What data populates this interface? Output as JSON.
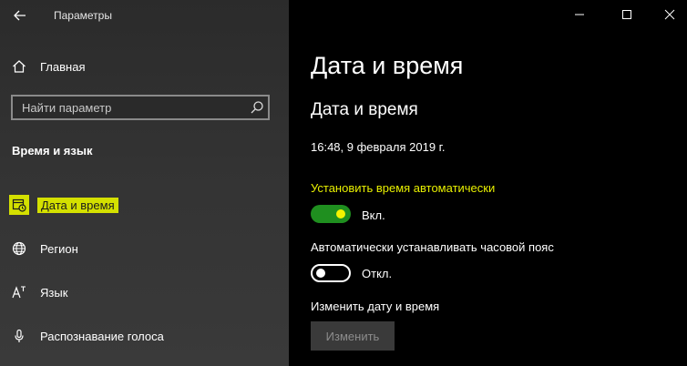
{
  "window": {
    "title": "Параметры",
    "buttons": {
      "minimize": "minimize-icon",
      "maximize": "maximize-icon",
      "close": "close-icon"
    }
  },
  "sidebar": {
    "home_label": "Главная",
    "search_placeholder": "Найти параметр",
    "section_title": "Время и язык",
    "items": [
      {
        "label": "Дата и время",
        "icon": "calendar-clock-icon",
        "selected": true
      },
      {
        "label": "Регион",
        "icon": "globe-icon"
      },
      {
        "label": "Язык",
        "icon": "language-icon"
      },
      {
        "label": "Распознавание голоса",
        "icon": "microphone-icon"
      }
    ]
  },
  "main": {
    "page_title": "Дата и время",
    "section_title": "Дата и время",
    "current_datetime": "16:48, 9 февраля 2019 г.",
    "auto_time": {
      "label": "Установить время автоматически",
      "state": "Вкл.",
      "on": true
    },
    "auto_timezone": {
      "label": "Автоматически устанавливать часовой пояс",
      "state": "Откл.",
      "on": false
    },
    "change": {
      "label": "Изменить дату и время",
      "button": "Изменить"
    }
  },
  "colors": {
    "highlight": "#d4e000",
    "highlight_text": "#e8f000",
    "toggle_on": "#1f8f1f",
    "sidebar_bg": "#333333",
    "main_bg": "#000000"
  }
}
